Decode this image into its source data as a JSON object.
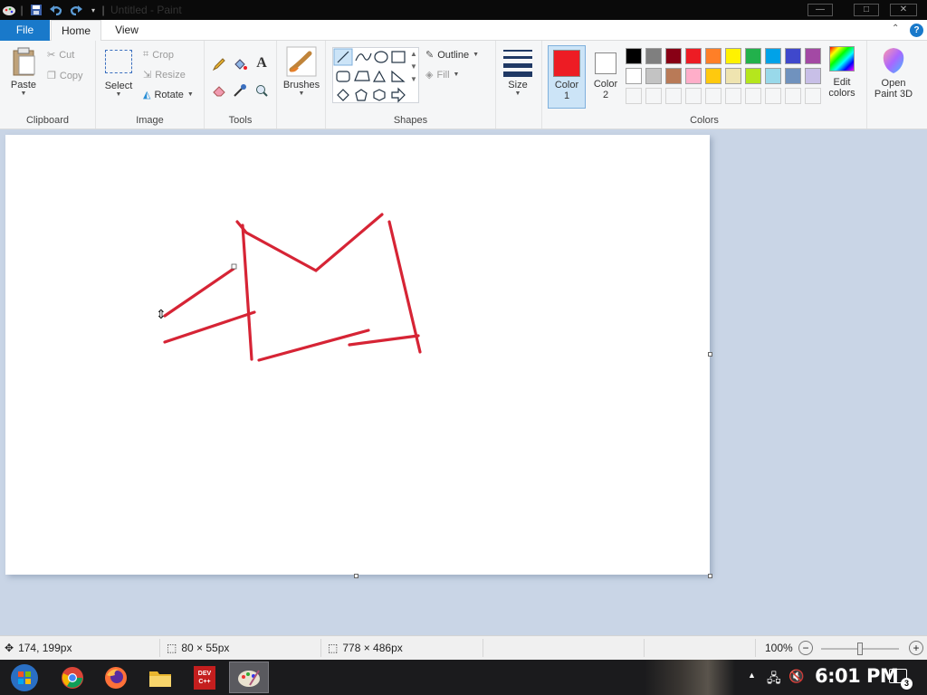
{
  "window": {
    "title": "Untitled - Paint"
  },
  "tabs": {
    "file": "File",
    "home": "Home",
    "view": "View"
  },
  "clipboard": {
    "paste": "Paste",
    "cut": "Cut",
    "copy": "Copy",
    "label": "Clipboard"
  },
  "image": {
    "select": "Select",
    "crop": "Crop",
    "resize": "Resize",
    "rotate": "Rotate",
    "label": "Image"
  },
  "tools": {
    "label": "Tools"
  },
  "brushes": {
    "label": "Brushes"
  },
  "shapes": {
    "outline": "Outline",
    "fill": "Fill",
    "label": "Shapes"
  },
  "size": {
    "label": "Size"
  },
  "colors": {
    "color1": "Color",
    "color1_num": "1",
    "color2": "Color",
    "color2_num": "2",
    "edit1": "Edit",
    "edit2": "colors",
    "label": "Colors",
    "color1_value": "#ed1c24",
    "color2_value": "#ffffff",
    "palette_row1": [
      "#000000",
      "#7f7f7f",
      "#880015",
      "#ed1c24",
      "#ff7f27",
      "#fff200",
      "#22b14c",
      "#00a2e8",
      "#3f48cc",
      "#a349a4"
    ],
    "palette_row2": [
      "#ffffff",
      "#c3c3c3",
      "#b97a57",
      "#ffaec9",
      "#ffc90e",
      "#efe4b0",
      "#b5e61d",
      "#99d9ea",
      "#7092be",
      "#c8bfe7"
    ]
  },
  "paint3d": {
    "line1": "Open",
    "line2": "Paint 3D"
  },
  "status": {
    "cursor_pos": "174, 199px",
    "selection_size": "80 × 55px",
    "canvas_size": "778 × 486px",
    "zoom": "100%",
    "zoom_level": 0.5
  },
  "taskbar": {
    "clock": "6:01 PM",
    "notifications": "3",
    "devcpp_label": "DEV C++"
  }
}
